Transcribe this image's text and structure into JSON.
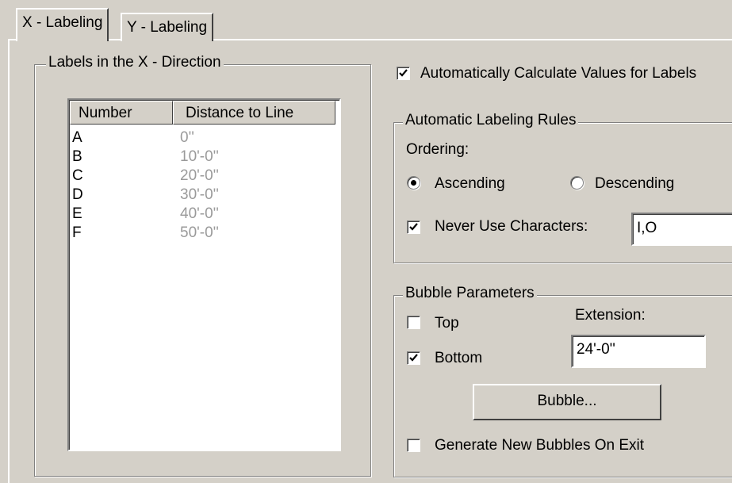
{
  "tabs": [
    {
      "label": "X - Labeling",
      "active": true
    },
    {
      "label": "Y - Labeling",
      "active": false
    }
  ],
  "labels_group": {
    "title": "Labels in the X - Direction",
    "columns": [
      "Number",
      "Distance to Line"
    ],
    "rows": [
      {
        "number": "A",
        "distance": "0''"
      },
      {
        "number": "B",
        "distance": "10'-0''"
      },
      {
        "number": "C",
        "distance": "20'-0''"
      },
      {
        "number": "D",
        "distance": "30'-0''"
      },
      {
        "number": "E",
        "distance": "40'-0''"
      },
      {
        "number": "F",
        "distance": "50'-0''"
      }
    ]
  },
  "auto_calc": {
    "label": "Automatically Calculate Values for Labels",
    "checked": true
  },
  "rules_group": {
    "title": "Automatic Labeling Rules",
    "ordering_label": "Ordering:",
    "ascending_label": "Ascending",
    "descending_label": "Descending",
    "selected": "Ascending",
    "never_use_label": "Never Use Characters:",
    "never_use_checked": true,
    "never_use_value": "I,O"
  },
  "bubble_group": {
    "title": "Bubble Parameters",
    "top_label": "Top",
    "top_checked": false,
    "bottom_label": "Bottom",
    "bottom_checked": true,
    "extension_label": "Extension:",
    "extension_value": "24'-0''",
    "bubble_button_label": "Bubble...",
    "generate_label": "Generate New Bubbles On Exit",
    "generate_checked": false
  }
}
